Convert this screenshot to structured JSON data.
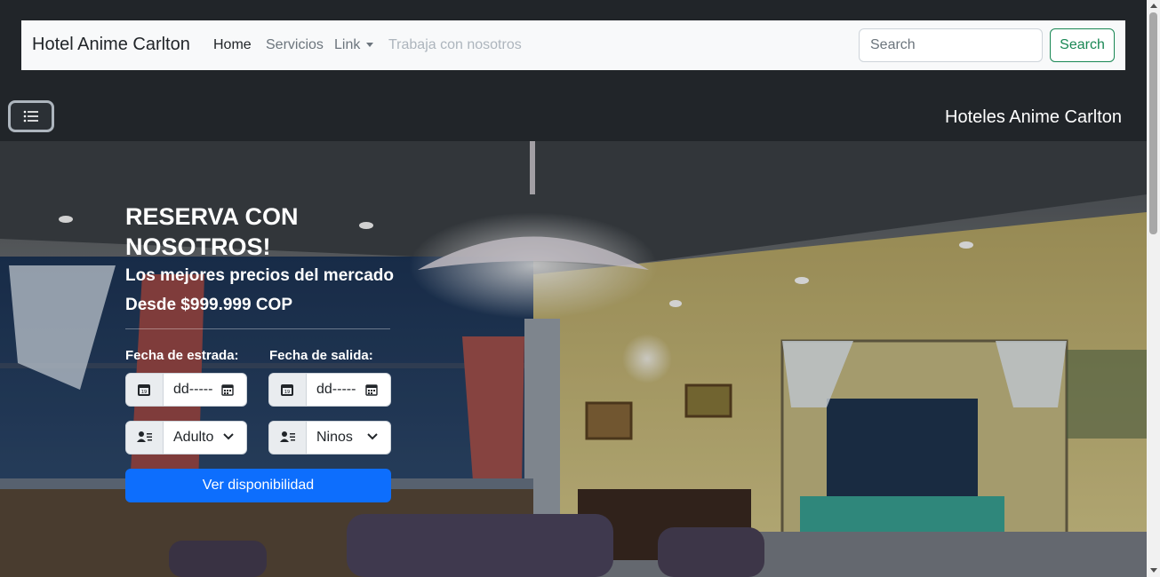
{
  "navbar": {
    "brand": "Hotel Anime Carlton",
    "links": [
      {
        "label": "Home",
        "state": "active"
      },
      {
        "label": "Servicios",
        "state": "normal"
      },
      {
        "label": "Link",
        "state": "dropdown"
      },
      {
        "label": "Trabaja con nosotros",
        "state": "disabled"
      }
    ],
    "search_placeholder": "Search",
    "search_button": "Search"
  },
  "offcanvas_bar": {
    "title": "Hoteles Anime Carlton",
    "toggler_icon": "list-icon"
  },
  "hero": {
    "title": "RESERVA CON NOSOTROS!",
    "subtitle": "Los mejores precios del mercado",
    "price": "Desde $999.999 COP",
    "checkin_label": "Fecha de estrada:",
    "checkout_label": "Fecha de salida:",
    "checkin_value": "dd-----",
    "checkout_value": "dd-----",
    "adults_value": "Adulto",
    "children_value": "Ninos",
    "submit_button": "Ver disponibilidad"
  },
  "colors": {
    "primary": "#0d6efd",
    "success": "#198754",
    "dark": "#212529",
    "light": "#f8f9fa"
  }
}
